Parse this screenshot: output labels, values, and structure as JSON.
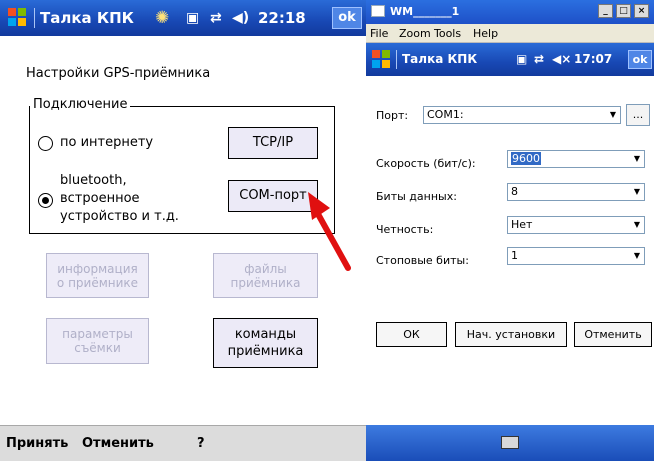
{
  "left": {
    "title": "Талка КПК",
    "time": "22:18",
    "ok": "ok",
    "page_title": "Настройки GPS-приёмника",
    "group_title": "Подключение",
    "radio_internet_label": "по интернету",
    "radio_bluetooth_label": [
      "bluetooth,",
      "встроенное",
      "устройство и т.д."
    ],
    "tcpip_button": "TCP/IP",
    "comport_button": "COM-порт",
    "info_button": [
      "информация",
      "о приёмнике"
    ],
    "files_button": [
      "файлы",
      "приёмника"
    ],
    "params_button": [
      "параметры",
      "съёмки"
    ],
    "commands_button": [
      "команды",
      "приёмника"
    ],
    "menu": {
      "accept": "Принять",
      "cancel": "Отменить",
      "help": "?"
    }
  },
  "right": {
    "window_title": "WM_______1",
    "window_controls": [
      "_",
      "□",
      "×"
    ],
    "menu": [
      "File",
      "Zoom",
      "Tools",
      "Help"
    ],
    "title": "Талка КПК",
    "time": "17:07",
    "ok": "ok",
    "port_label": "Порт:",
    "port_value": "COM1:",
    "browse_button": "...",
    "speed_label": "Скорость (бит/с):",
    "speed_value": "9600",
    "databits_label": "Биты данных:",
    "databits_value": "8",
    "parity_label": "Четность:",
    "parity_value": "Нет",
    "stopbits_label": "Стоповые биты:",
    "stopbits_value": "1",
    "ok_button": "ОК",
    "defaults_button": "Нач. установки",
    "cancel_button": "Отменить"
  },
  "colors": {
    "titlebar": "#1848b4",
    "arrow": "#e01010",
    "selection": "#316ac5"
  }
}
